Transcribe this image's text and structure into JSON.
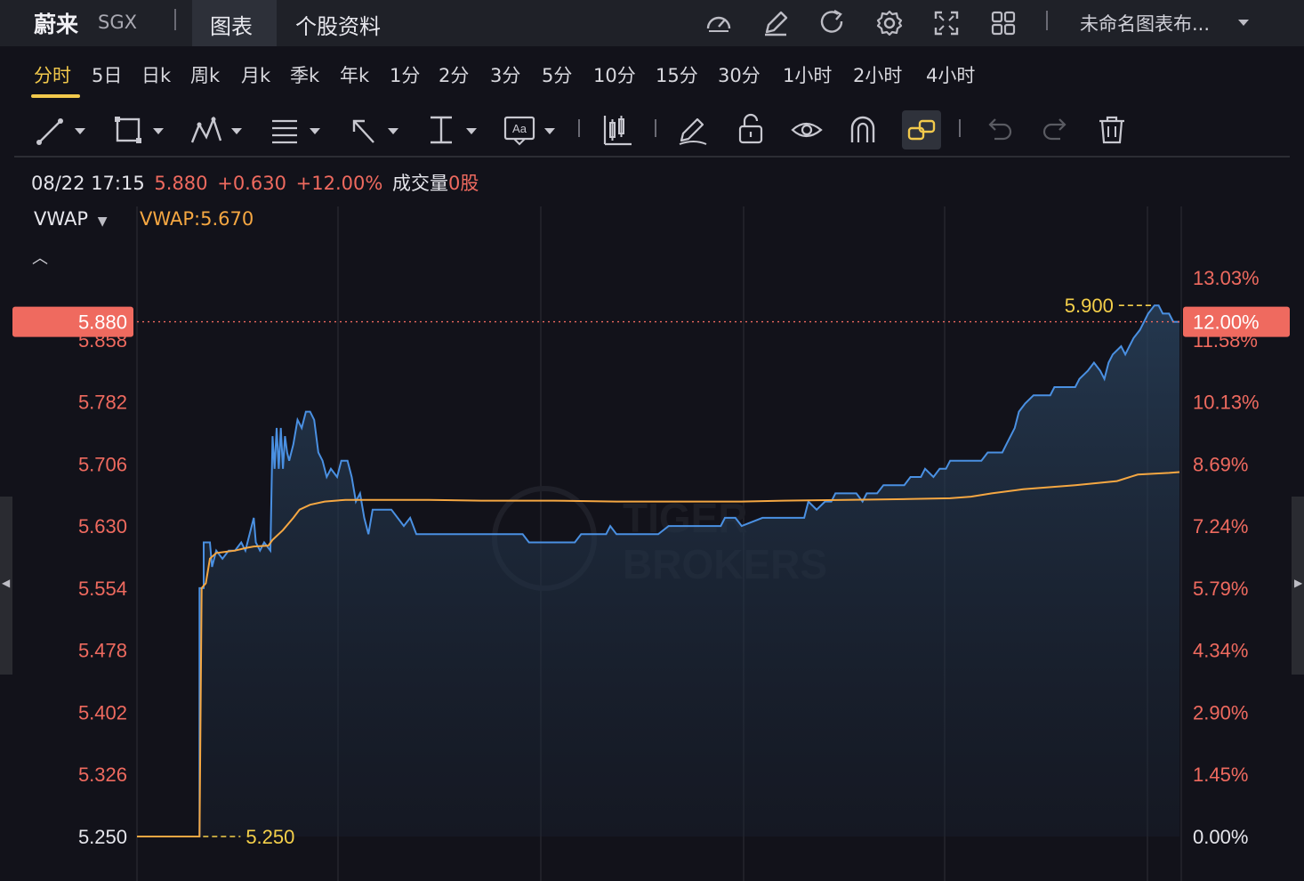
{
  "topbar": {
    "name": "蔚来",
    "exchange": "SGX",
    "tabs": [
      "图表",
      "个股资料"
    ],
    "active_tab": "图表",
    "layout_name": "未命名图表布...",
    "icons": [
      "speed-icon",
      "edit-icon",
      "refresh-icon",
      "settings-icon",
      "fullscreen-icon",
      "grid-icon",
      "dropdown-icon"
    ]
  },
  "periods": [
    "分时",
    "5日",
    "日k",
    "周k",
    "月k",
    "季k",
    "年k",
    "1分",
    "2分",
    "3分",
    "5分",
    "10分",
    "15分",
    "30分",
    "1小时",
    "2小时",
    "4小时"
  ],
  "active_period": "分时",
  "toolbar": {
    "icons": [
      "trend-line-icon",
      "rectangle-icon",
      "pattern-icon",
      "fibonacci-icon",
      "arrow-icon",
      "measure-icon",
      "text-icon",
      "indicator-icon",
      "brush-icon",
      "lock-icon",
      "eye-icon",
      "magnet-icon",
      "link-icon",
      "undo-icon",
      "redo-icon",
      "trash-icon"
    ],
    "active": "link-icon"
  },
  "info": {
    "datetime": "08/22 17:15",
    "price": "5.880",
    "change": "+0.630",
    "change_pct": "+12.00%",
    "volume_label": "成交量",
    "volume_value": "0股"
  },
  "indicator": {
    "name": "VWAP",
    "value_text": "VWAP:5.670"
  },
  "watermark": {
    "line1": "TIGER",
    "line2": "BROKERS",
    "icon": "tiger-logo-icon"
  },
  "colors": {
    "price_line": "#4a90e2",
    "vwap_line": "#f5a742",
    "up": "#ef6a5f",
    "highlight": "#f5d04a",
    "bg": "#12121a"
  },
  "chart_data": {
    "type": "line",
    "ylim": [
      5.25,
      5.955
    ],
    "xlim": [
      0,
      1000
    ],
    "y_ticks": [
      "5.250",
      "5.326",
      "5.402",
      "5.478",
      "5.554",
      "5.630",
      "5.706",
      "5.782",
      "5.858"
    ],
    "y_tick_values": [
      5.25,
      5.326,
      5.402,
      5.478,
      5.554,
      5.63,
      5.706,
      5.782,
      5.858
    ],
    "pct_ticks": [
      "0.00%",
      "1.45%",
      "2.90%",
      "4.34%",
      "5.79%",
      "7.24%",
      "8.69%",
      "10.13%",
      "11.58%",
      "13.03%"
    ],
    "pct_tick_values": [
      5.25,
      5.326,
      5.402,
      5.478,
      5.554,
      5.63,
      5.706,
      5.782,
      5.858,
      5.934
    ],
    "current_price": 5.88,
    "current_price_label": "5.880",
    "current_pct_label": "12.00%",
    "high_label": "5.900",
    "low_label": "5.250",
    "series": [
      {
        "name": "price",
        "points": [
          [
            0,
            5.25
          ],
          [
            60,
            5.25
          ],
          [
            60,
            5.554
          ],
          [
            64,
            5.554
          ],
          [
            64,
            5.61
          ],
          [
            70,
            5.61
          ],
          [
            72,
            5.58
          ],
          [
            76,
            5.6
          ],
          [
            82,
            5.59
          ],
          [
            88,
            5.6
          ],
          [
            94,
            5.6
          ],
          [
            100,
            5.61
          ],
          [
            104,
            5.6
          ],
          [
            108,
            5.62
          ],
          [
            112,
            5.64
          ],
          [
            114,
            5.61
          ],
          [
            118,
            5.6
          ],
          [
            122,
            5.61
          ],
          [
            128,
            5.6
          ],
          [
            130,
            5.74
          ],
          [
            132,
            5.7
          ],
          [
            134,
            5.75
          ],
          [
            136,
            5.7
          ],
          [
            138,
            5.75
          ],
          [
            140,
            5.7
          ],
          [
            142,
            5.74
          ],
          [
            144,
            5.72
          ],
          [
            146,
            5.71
          ],
          [
            150,
            5.73
          ],
          [
            154,
            5.76
          ],
          [
            158,
            5.75
          ],
          [
            162,
            5.77
          ],
          [
            166,
            5.77
          ],
          [
            170,
            5.76
          ],
          [
            174,
            5.72
          ],
          [
            178,
            5.71
          ],
          [
            182,
            5.69
          ],
          [
            186,
            5.7
          ],
          [
            192,
            5.69
          ],
          [
            196,
            5.71
          ],
          [
            202,
            5.71
          ],
          [
            206,
            5.69
          ],
          [
            210,
            5.66
          ],
          [
            214,
            5.67
          ],
          [
            218,
            5.64
          ],
          [
            222,
            5.62
          ],
          [
            226,
            5.65
          ],
          [
            232,
            5.65
          ],
          [
            244,
            5.65
          ],
          [
            250,
            5.64
          ],
          [
            256,
            5.63
          ],
          [
            262,
            5.64
          ],
          [
            268,
            5.62
          ],
          [
            290,
            5.62
          ],
          [
            330,
            5.62
          ],
          [
            370,
            5.62
          ],
          [
            376,
            5.61
          ],
          [
            420,
            5.61
          ],
          [
            426,
            5.62
          ],
          [
            450,
            5.62
          ],
          [
            454,
            5.63
          ],
          [
            460,
            5.62
          ],
          [
            490,
            5.62
          ],
          [
            500,
            5.62
          ],
          [
            510,
            5.63
          ],
          [
            560,
            5.63
          ],
          [
            564,
            5.64
          ],
          [
            574,
            5.64
          ],
          [
            580,
            5.63
          ],
          [
            600,
            5.64
          ],
          [
            640,
            5.64
          ],
          [
            644,
            5.66
          ],
          [
            652,
            5.65
          ],
          [
            660,
            5.66
          ],
          [
            666,
            5.66
          ],
          [
            670,
            5.67
          ],
          [
            690,
            5.67
          ],
          [
            696,
            5.66
          ],
          [
            700,
            5.67
          ],
          [
            710,
            5.67
          ],
          [
            716,
            5.68
          ],
          [
            736,
            5.68
          ],
          [
            742,
            5.69
          ],
          [
            752,
            5.69
          ],
          [
            756,
            5.7
          ],
          [
            764,
            5.69
          ],
          [
            770,
            5.7
          ],
          [
            776,
            5.7
          ],
          [
            780,
            5.71
          ],
          [
            810,
            5.71
          ],
          [
            816,
            5.72
          ],
          [
            830,
            5.72
          ],
          [
            834,
            5.73
          ],
          [
            842,
            5.75
          ],
          [
            846,
            5.77
          ],
          [
            852,
            5.78
          ],
          [
            860,
            5.79
          ],
          [
            876,
            5.79
          ],
          [
            880,
            5.8
          ],
          [
            900,
            5.8
          ],
          [
            904,
            5.81
          ],
          [
            912,
            5.82
          ],
          [
            918,
            5.83
          ],
          [
            924,
            5.82
          ],
          [
            928,
            5.81
          ],
          [
            932,
            5.83
          ],
          [
            936,
            5.84
          ],
          [
            944,
            5.85
          ],
          [
            948,
            5.84
          ],
          [
            952,
            5.85
          ],
          [
            956,
            5.86
          ],
          [
            962,
            5.87
          ],
          [
            966,
            5.88
          ],
          [
            970,
            5.89
          ],
          [
            976,
            5.9
          ],
          [
            980,
            5.9
          ],
          [
            984,
            5.89
          ],
          [
            990,
            5.89
          ],
          [
            994,
            5.88
          ],
          [
            1000,
            5.88
          ]
        ]
      },
      {
        "name": "VWAP",
        "points": [
          [
            0,
            5.25
          ],
          [
            60,
            5.25
          ],
          [
            62,
            5.554
          ],
          [
            66,
            5.56
          ],
          [
            70,
            5.59
          ],
          [
            76,
            5.597
          ],
          [
            94,
            5.6
          ],
          [
            104,
            5.603
          ],
          [
            112,
            5.605
          ],
          [
            126,
            5.606
          ],
          [
            130,
            5.613
          ],
          [
            140,
            5.625
          ],
          [
            150,
            5.64
          ],
          [
            156,
            5.65
          ],
          [
            166,
            5.656
          ],
          [
            180,
            5.66
          ],
          [
            200,
            5.662
          ],
          [
            230,
            5.662
          ],
          [
            280,
            5.662
          ],
          [
            330,
            5.661
          ],
          [
            400,
            5.661
          ],
          [
            460,
            5.66
          ],
          [
            520,
            5.66
          ],
          [
            580,
            5.66
          ],
          [
            620,
            5.661
          ],
          [
            680,
            5.662
          ],
          [
            740,
            5.663
          ],
          [
            780,
            5.664
          ],
          [
            800,
            5.666
          ],
          [
            820,
            5.67
          ],
          [
            850,
            5.675
          ],
          [
            900,
            5.68
          ],
          [
            940,
            5.685
          ],
          [
            960,
            5.693
          ],
          [
            990,
            5.695
          ],
          [
            1000,
            5.696
          ]
        ]
      }
    ]
  }
}
